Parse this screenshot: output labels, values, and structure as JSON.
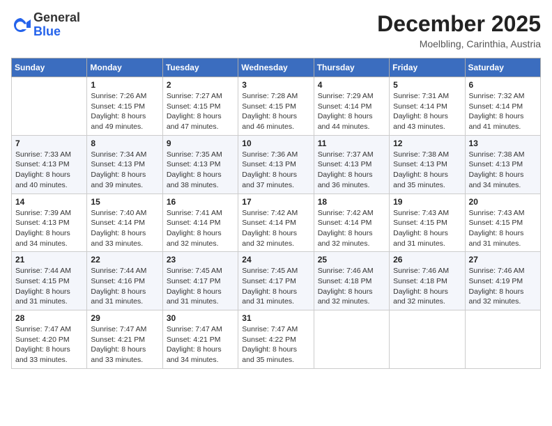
{
  "logo": {
    "general": "General",
    "blue": "Blue"
  },
  "header": {
    "month": "December 2025",
    "location": "Moelbling, Carinthia, Austria"
  },
  "weekdays": [
    "Sunday",
    "Monday",
    "Tuesday",
    "Wednesday",
    "Thursday",
    "Friday",
    "Saturday"
  ],
  "weeks": [
    [
      {
        "day": "",
        "info": ""
      },
      {
        "day": "1",
        "info": "Sunrise: 7:26 AM\nSunset: 4:15 PM\nDaylight: 8 hours\nand 49 minutes."
      },
      {
        "day": "2",
        "info": "Sunrise: 7:27 AM\nSunset: 4:15 PM\nDaylight: 8 hours\nand 47 minutes."
      },
      {
        "day": "3",
        "info": "Sunrise: 7:28 AM\nSunset: 4:15 PM\nDaylight: 8 hours\nand 46 minutes."
      },
      {
        "day": "4",
        "info": "Sunrise: 7:29 AM\nSunset: 4:14 PM\nDaylight: 8 hours\nand 44 minutes."
      },
      {
        "day": "5",
        "info": "Sunrise: 7:31 AM\nSunset: 4:14 PM\nDaylight: 8 hours\nand 43 minutes."
      },
      {
        "day": "6",
        "info": "Sunrise: 7:32 AM\nSunset: 4:14 PM\nDaylight: 8 hours\nand 41 minutes."
      }
    ],
    [
      {
        "day": "7",
        "info": "Sunrise: 7:33 AM\nSunset: 4:13 PM\nDaylight: 8 hours\nand 40 minutes."
      },
      {
        "day": "8",
        "info": "Sunrise: 7:34 AM\nSunset: 4:13 PM\nDaylight: 8 hours\nand 39 minutes."
      },
      {
        "day": "9",
        "info": "Sunrise: 7:35 AM\nSunset: 4:13 PM\nDaylight: 8 hours\nand 38 minutes."
      },
      {
        "day": "10",
        "info": "Sunrise: 7:36 AM\nSunset: 4:13 PM\nDaylight: 8 hours\nand 37 minutes."
      },
      {
        "day": "11",
        "info": "Sunrise: 7:37 AM\nSunset: 4:13 PM\nDaylight: 8 hours\nand 36 minutes."
      },
      {
        "day": "12",
        "info": "Sunrise: 7:38 AM\nSunset: 4:13 PM\nDaylight: 8 hours\nand 35 minutes."
      },
      {
        "day": "13",
        "info": "Sunrise: 7:38 AM\nSunset: 4:13 PM\nDaylight: 8 hours\nand 34 minutes."
      }
    ],
    [
      {
        "day": "14",
        "info": "Sunrise: 7:39 AM\nSunset: 4:13 PM\nDaylight: 8 hours\nand 34 minutes."
      },
      {
        "day": "15",
        "info": "Sunrise: 7:40 AM\nSunset: 4:14 PM\nDaylight: 8 hours\nand 33 minutes."
      },
      {
        "day": "16",
        "info": "Sunrise: 7:41 AM\nSunset: 4:14 PM\nDaylight: 8 hours\nand 32 minutes."
      },
      {
        "day": "17",
        "info": "Sunrise: 7:42 AM\nSunset: 4:14 PM\nDaylight: 8 hours\nand 32 minutes."
      },
      {
        "day": "18",
        "info": "Sunrise: 7:42 AM\nSunset: 4:14 PM\nDaylight: 8 hours\nand 32 minutes."
      },
      {
        "day": "19",
        "info": "Sunrise: 7:43 AM\nSunset: 4:15 PM\nDaylight: 8 hours\nand 31 minutes."
      },
      {
        "day": "20",
        "info": "Sunrise: 7:43 AM\nSunset: 4:15 PM\nDaylight: 8 hours\nand 31 minutes."
      }
    ],
    [
      {
        "day": "21",
        "info": "Sunrise: 7:44 AM\nSunset: 4:15 PM\nDaylight: 8 hours\nand 31 minutes."
      },
      {
        "day": "22",
        "info": "Sunrise: 7:44 AM\nSunset: 4:16 PM\nDaylight: 8 hours\nand 31 minutes."
      },
      {
        "day": "23",
        "info": "Sunrise: 7:45 AM\nSunset: 4:17 PM\nDaylight: 8 hours\nand 31 minutes."
      },
      {
        "day": "24",
        "info": "Sunrise: 7:45 AM\nSunset: 4:17 PM\nDaylight: 8 hours\nand 31 minutes."
      },
      {
        "day": "25",
        "info": "Sunrise: 7:46 AM\nSunset: 4:18 PM\nDaylight: 8 hours\nand 32 minutes."
      },
      {
        "day": "26",
        "info": "Sunrise: 7:46 AM\nSunset: 4:18 PM\nDaylight: 8 hours\nand 32 minutes."
      },
      {
        "day": "27",
        "info": "Sunrise: 7:46 AM\nSunset: 4:19 PM\nDaylight: 8 hours\nand 32 minutes."
      }
    ],
    [
      {
        "day": "28",
        "info": "Sunrise: 7:47 AM\nSunset: 4:20 PM\nDaylight: 8 hours\nand 33 minutes."
      },
      {
        "day": "29",
        "info": "Sunrise: 7:47 AM\nSunset: 4:21 PM\nDaylight: 8 hours\nand 33 minutes."
      },
      {
        "day": "30",
        "info": "Sunrise: 7:47 AM\nSunset: 4:21 PM\nDaylight: 8 hours\nand 34 minutes."
      },
      {
        "day": "31",
        "info": "Sunrise: 7:47 AM\nSunset: 4:22 PM\nDaylight: 8 hours\nand 35 minutes."
      },
      {
        "day": "",
        "info": ""
      },
      {
        "day": "",
        "info": ""
      },
      {
        "day": "",
        "info": ""
      }
    ]
  ]
}
